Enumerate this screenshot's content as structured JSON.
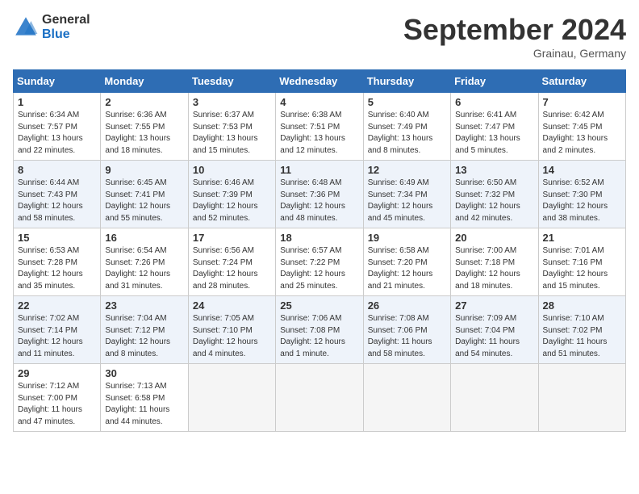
{
  "header": {
    "logo_general": "General",
    "logo_blue": "Blue",
    "month": "September 2024",
    "location": "Grainau, Germany"
  },
  "days_of_week": [
    "Sunday",
    "Monday",
    "Tuesday",
    "Wednesday",
    "Thursday",
    "Friday",
    "Saturday"
  ],
  "weeks": [
    [
      {
        "num": "1",
        "lines": [
          "Sunrise: 6:34 AM",
          "Sunset: 7:57 PM",
          "Daylight: 13 hours",
          "and 22 minutes."
        ]
      },
      {
        "num": "2",
        "lines": [
          "Sunrise: 6:36 AM",
          "Sunset: 7:55 PM",
          "Daylight: 13 hours",
          "and 18 minutes."
        ]
      },
      {
        "num": "3",
        "lines": [
          "Sunrise: 6:37 AM",
          "Sunset: 7:53 PM",
          "Daylight: 13 hours",
          "and 15 minutes."
        ]
      },
      {
        "num": "4",
        "lines": [
          "Sunrise: 6:38 AM",
          "Sunset: 7:51 PM",
          "Daylight: 13 hours",
          "and 12 minutes."
        ]
      },
      {
        "num": "5",
        "lines": [
          "Sunrise: 6:40 AM",
          "Sunset: 7:49 PM",
          "Daylight: 13 hours",
          "and 8 minutes."
        ]
      },
      {
        "num": "6",
        "lines": [
          "Sunrise: 6:41 AM",
          "Sunset: 7:47 PM",
          "Daylight: 13 hours",
          "and 5 minutes."
        ]
      },
      {
        "num": "7",
        "lines": [
          "Sunrise: 6:42 AM",
          "Sunset: 7:45 PM",
          "Daylight: 13 hours",
          "and 2 minutes."
        ]
      }
    ],
    [
      {
        "num": "8",
        "lines": [
          "Sunrise: 6:44 AM",
          "Sunset: 7:43 PM",
          "Daylight: 12 hours",
          "and 58 minutes."
        ]
      },
      {
        "num": "9",
        "lines": [
          "Sunrise: 6:45 AM",
          "Sunset: 7:41 PM",
          "Daylight: 12 hours",
          "and 55 minutes."
        ]
      },
      {
        "num": "10",
        "lines": [
          "Sunrise: 6:46 AM",
          "Sunset: 7:39 PM",
          "Daylight: 12 hours",
          "and 52 minutes."
        ]
      },
      {
        "num": "11",
        "lines": [
          "Sunrise: 6:48 AM",
          "Sunset: 7:36 PM",
          "Daylight: 12 hours",
          "and 48 minutes."
        ]
      },
      {
        "num": "12",
        "lines": [
          "Sunrise: 6:49 AM",
          "Sunset: 7:34 PM",
          "Daylight: 12 hours",
          "and 45 minutes."
        ]
      },
      {
        "num": "13",
        "lines": [
          "Sunrise: 6:50 AM",
          "Sunset: 7:32 PM",
          "Daylight: 12 hours",
          "and 42 minutes."
        ]
      },
      {
        "num": "14",
        "lines": [
          "Sunrise: 6:52 AM",
          "Sunset: 7:30 PM",
          "Daylight: 12 hours",
          "and 38 minutes."
        ]
      }
    ],
    [
      {
        "num": "15",
        "lines": [
          "Sunrise: 6:53 AM",
          "Sunset: 7:28 PM",
          "Daylight: 12 hours",
          "and 35 minutes."
        ]
      },
      {
        "num": "16",
        "lines": [
          "Sunrise: 6:54 AM",
          "Sunset: 7:26 PM",
          "Daylight: 12 hours",
          "and 31 minutes."
        ]
      },
      {
        "num": "17",
        "lines": [
          "Sunrise: 6:56 AM",
          "Sunset: 7:24 PM",
          "Daylight: 12 hours",
          "and 28 minutes."
        ]
      },
      {
        "num": "18",
        "lines": [
          "Sunrise: 6:57 AM",
          "Sunset: 7:22 PM",
          "Daylight: 12 hours",
          "and 25 minutes."
        ]
      },
      {
        "num": "19",
        "lines": [
          "Sunrise: 6:58 AM",
          "Sunset: 7:20 PM",
          "Daylight: 12 hours",
          "and 21 minutes."
        ]
      },
      {
        "num": "20",
        "lines": [
          "Sunrise: 7:00 AM",
          "Sunset: 7:18 PM",
          "Daylight: 12 hours",
          "and 18 minutes."
        ]
      },
      {
        "num": "21",
        "lines": [
          "Sunrise: 7:01 AM",
          "Sunset: 7:16 PM",
          "Daylight: 12 hours",
          "and 15 minutes."
        ]
      }
    ],
    [
      {
        "num": "22",
        "lines": [
          "Sunrise: 7:02 AM",
          "Sunset: 7:14 PM",
          "Daylight: 12 hours",
          "and 11 minutes."
        ]
      },
      {
        "num": "23",
        "lines": [
          "Sunrise: 7:04 AM",
          "Sunset: 7:12 PM",
          "Daylight: 12 hours",
          "and 8 minutes."
        ]
      },
      {
        "num": "24",
        "lines": [
          "Sunrise: 7:05 AM",
          "Sunset: 7:10 PM",
          "Daylight: 12 hours",
          "and 4 minutes."
        ]
      },
      {
        "num": "25",
        "lines": [
          "Sunrise: 7:06 AM",
          "Sunset: 7:08 PM",
          "Daylight: 12 hours",
          "and 1 minute."
        ]
      },
      {
        "num": "26",
        "lines": [
          "Sunrise: 7:08 AM",
          "Sunset: 7:06 PM",
          "Daylight: 11 hours",
          "and 58 minutes."
        ]
      },
      {
        "num": "27",
        "lines": [
          "Sunrise: 7:09 AM",
          "Sunset: 7:04 PM",
          "Daylight: 11 hours",
          "and 54 minutes."
        ]
      },
      {
        "num": "28",
        "lines": [
          "Sunrise: 7:10 AM",
          "Sunset: 7:02 PM",
          "Daylight: 11 hours",
          "and 51 minutes."
        ]
      }
    ],
    [
      {
        "num": "29",
        "lines": [
          "Sunrise: 7:12 AM",
          "Sunset: 7:00 PM",
          "Daylight: 11 hours",
          "and 47 minutes."
        ]
      },
      {
        "num": "30",
        "lines": [
          "Sunrise: 7:13 AM",
          "Sunset: 6:58 PM",
          "Daylight: 11 hours",
          "and 44 minutes."
        ]
      },
      null,
      null,
      null,
      null,
      null
    ]
  ]
}
